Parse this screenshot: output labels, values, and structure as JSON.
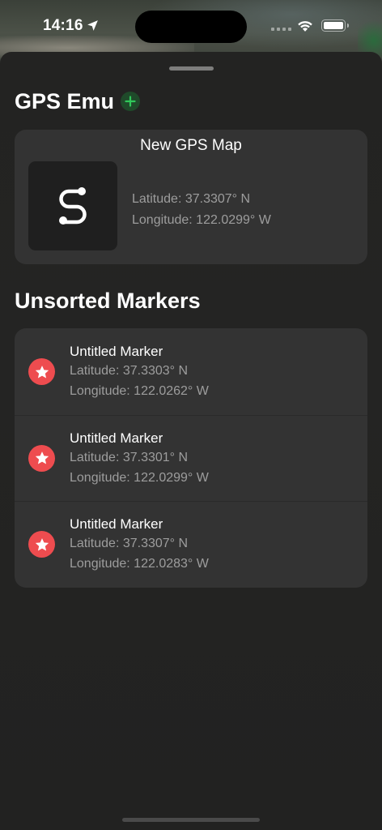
{
  "status_bar": {
    "time": "14:16",
    "icons": [
      "location-arrow-icon",
      "signal-icon",
      "wifi-icon",
      "battery-icon"
    ]
  },
  "header": {
    "title": "GPS Emu",
    "add_icon": "plus-circle-icon",
    "accent_color": "#30c85a"
  },
  "map_card": {
    "name": "New GPS Map",
    "thumbnail_icon": "route-icon",
    "latitude": "Latitude: 37.3307° N",
    "longitude": "Longitude: 122.0299° W"
  },
  "unsorted": {
    "title": "Unsorted Markers",
    "marker_color": "#ee4c4f",
    "marker_icon": "star-icon",
    "items": [
      {
        "title": "Untitled Marker",
        "latitude": "Latitude: 37.3303° N",
        "longitude": "Longitude: 122.0262° W"
      },
      {
        "title": "Untitled Marker",
        "latitude": "Latitude: 37.3301° N",
        "longitude": "Longitude: 122.0299° W"
      },
      {
        "title": "Untitled Marker",
        "latitude": "Latitude: 37.3307° N",
        "longitude": "Longitude: 122.0283° W"
      }
    ]
  }
}
